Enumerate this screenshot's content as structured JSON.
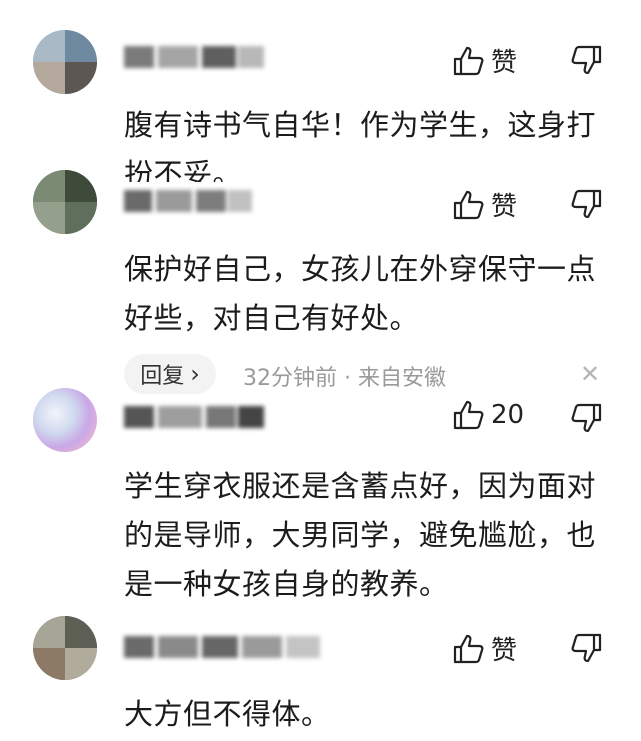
{
  "comments": [
    {
      "like_label": "赞",
      "text": "腹有诗书气自华！作为学生，这身打扮不妥。"
    },
    {
      "like_label": "赞",
      "text": "保护好自己，女孩儿在外穿保守一点好些，对自己有好处。",
      "reply_label": "回复",
      "reply_chevron": "›",
      "time": "32分钟前",
      "separator": "·",
      "location": "来自安徽",
      "close": "✕"
    },
    {
      "like_label": "20",
      "text": "学生穿衣服还是含蓄点好，因为面对的是导师，大男同学，避免尴尬，也是一种女孩自身的教养。"
    },
    {
      "like_label": "赞",
      "text": "大方但不得体。"
    }
  ],
  "icons": {
    "like": "thumbs-up-icon",
    "dislike": "thumbs-down-icon",
    "close": "close-icon"
  },
  "colors": {
    "text": "#1c1c1c",
    "meta": "#9a9a9a",
    "reply_bg": "#f3f3f3"
  }
}
